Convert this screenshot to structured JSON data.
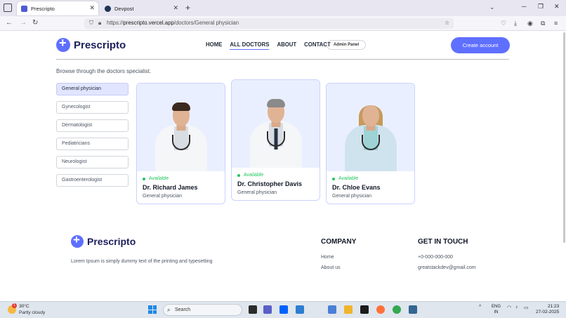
{
  "browser": {
    "tabs": [
      {
        "title": "Prescripto",
        "active": true
      },
      {
        "title": "Devpost",
        "active": false
      }
    ],
    "url_prefix": "https://",
    "url_host": "prescripto.vercel.app",
    "url_path": "/doctors/General physician"
  },
  "header": {
    "brand": "Prescripto",
    "nav": [
      "HOME",
      "ALL DOCTORS",
      "ABOUT",
      "CONTACT"
    ],
    "admin_label": "Admin Panel",
    "cta_label": "Create account"
  },
  "main": {
    "intro": "Browse through the doctors specialist.",
    "specialities": [
      "General physician",
      "Gynecologist",
      "Dermatologist",
      "Pediatricians",
      "Neurologist",
      "Gastroenterologist"
    ],
    "doctors": [
      {
        "status": "Available",
        "name": "Dr. Richard James",
        "speciality": "General physician"
      },
      {
        "status": "Available",
        "name": "Dr. Christopher Davis",
        "speciality": "General physician"
      },
      {
        "status": "Available",
        "name": "Dr. Chloe Evans",
        "speciality": "General physician"
      }
    ]
  },
  "footer": {
    "brand": "Prescripto",
    "text": "Lorem Ipsum is simply dummy text of the printing and typesetting",
    "company_heading": "COMPANY",
    "company_links": [
      "Home",
      "About us"
    ],
    "contact_heading": "GET IN TOUCH",
    "phone": "+0-000-000-000",
    "email": "greatstackdev@gmail.com"
  },
  "taskbar": {
    "temperature": "30°C",
    "condition": "Partly cloudy",
    "weather_badge": "1",
    "search_placeholder": "Search",
    "lang_top": "ENG",
    "lang_bottom": "IN",
    "time": "21:23",
    "date": "27-02-2025"
  },
  "colors": {
    "accent": "#5f6fff",
    "available": "#22c55e",
    "card_bg": "#eaefff"
  }
}
